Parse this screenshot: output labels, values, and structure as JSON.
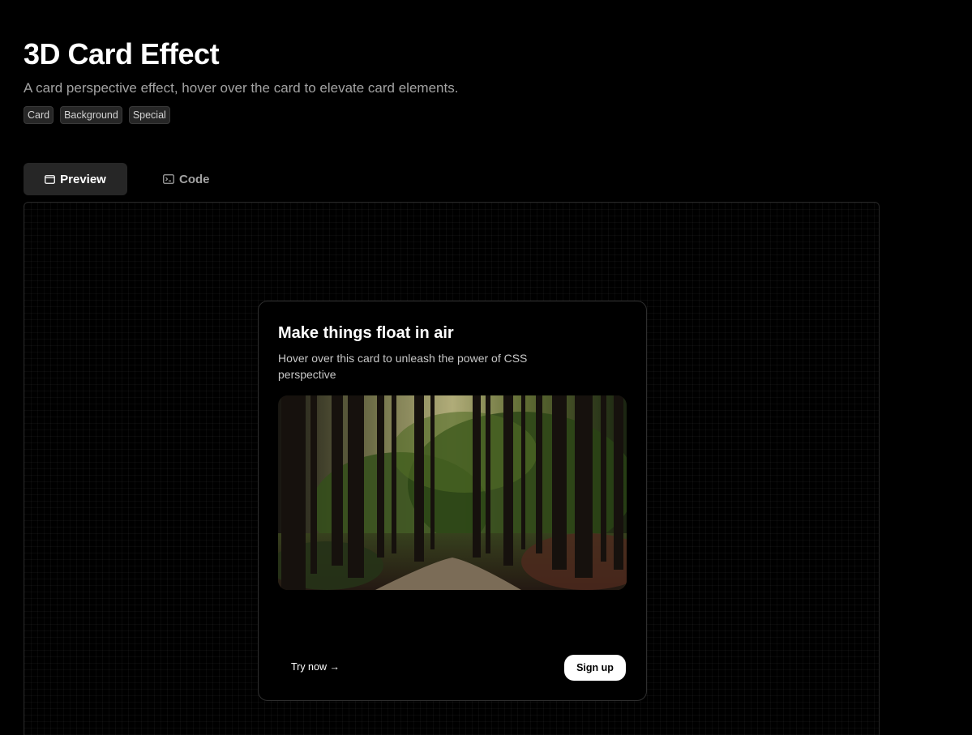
{
  "header": {
    "title": "3D Card Effect",
    "subtitle": "A card perspective effect, hover over the card to elevate card elements."
  },
  "tags": [
    "Card",
    "Background",
    "Special"
  ],
  "tabs": [
    {
      "label": "Preview",
      "icon": "window-icon",
      "active": true
    },
    {
      "label": "Code",
      "icon": "terminal-icon",
      "active": false
    }
  ],
  "card": {
    "title": "Make things float in air",
    "description": "Hover over this card to unleash the power of CSS perspective",
    "image_alt": "forest-trail-photo",
    "try_now_label": "Try now →",
    "signup_label": "Sign up"
  },
  "colors": {
    "background": "#000000",
    "muted_text": "#a3a3a3",
    "tab_active_bg": "#262626",
    "card_border": "#2e2e2e",
    "button_bg": "#ffffff"
  }
}
